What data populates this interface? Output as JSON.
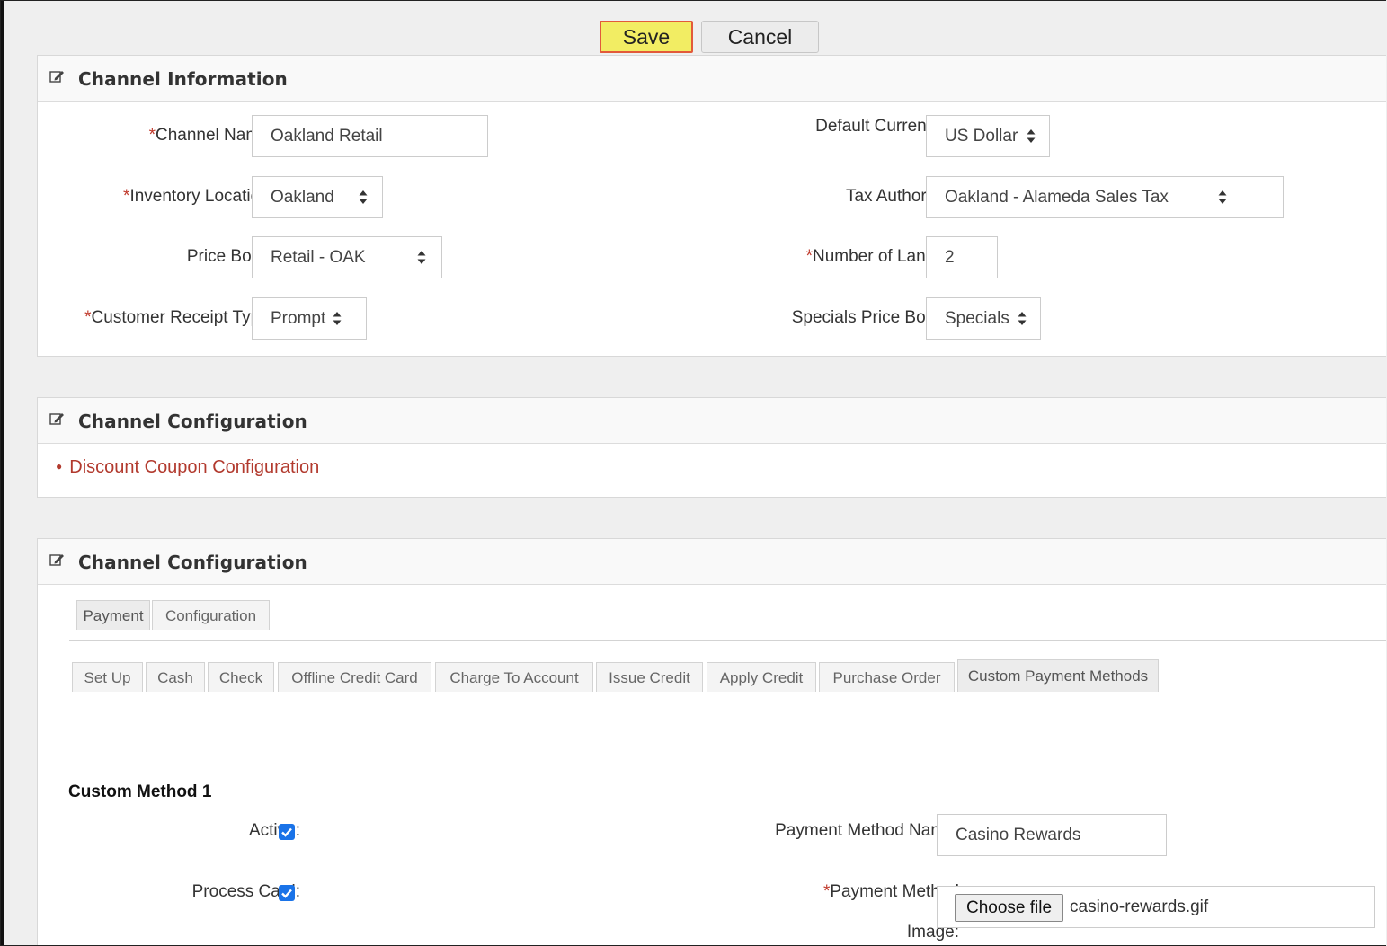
{
  "toolbar": {
    "save_label": "Save",
    "cancel_label": "Cancel"
  },
  "channel_info": {
    "title": "Channel Information",
    "fields": {
      "channel_name": {
        "label": "Channel Name:",
        "value": "Oakland Retail"
      },
      "inventory_location": {
        "label": "Inventory Location:",
        "value": "Oakland"
      },
      "price_book": {
        "label": "Price Book:",
        "value": "Retail - OAK"
      },
      "customer_receipt_type": {
        "label": "Customer Receipt Type:",
        "value": "Prompt"
      },
      "default_currency": {
        "label": "Default Currency:",
        "value": "US Dollar"
      },
      "tax_authority": {
        "label": "Tax Authority:",
        "value": "Oakland - Alameda Sales Tax"
      },
      "number_of_lanes": {
        "label": "Number of Lanes:",
        "value": "2"
      },
      "specials_price_book": {
        "label": "Specials Price Book:",
        "value": "Specials"
      }
    }
  },
  "channel_config_1": {
    "title": "Channel Configuration",
    "links": [
      "Discount Coupon Configuration"
    ]
  },
  "channel_config_2": {
    "title": "Channel Configuration",
    "top_tabs": [
      "Payment",
      "Configuration"
    ],
    "sub_tabs": [
      "Set Up",
      "Cash",
      "Check",
      "Offline Credit Card",
      "Charge To Account",
      "Issue Credit",
      "Apply Credit",
      "Purchase Order",
      "Custom Payment Methods"
    ],
    "active_sub_tab": "Custom Payment Methods",
    "custom_method": {
      "title": "Custom Method 1",
      "active_label": "Active:",
      "process_card_label": "Process Card:",
      "name_label": "Payment Method Name:",
      "name_value": "Casino Rewards",
      "image_label_line1": "Payment Method",
      "image_label_line2": "Image:",
      "choose_file_label": "Choose file",
      "file_name": "casino-rewards.gif",
      "active_checked": true,
      "process_card_checked": true
    }
  },
  "colors": {
    "required_marker": "#c0392b",
    "link": "#b23a2e",
    "save_bg": "#f2ed63",
    "save_border": "#e25a3a",
    "checkbox": "#1a73e8"
  }
}
